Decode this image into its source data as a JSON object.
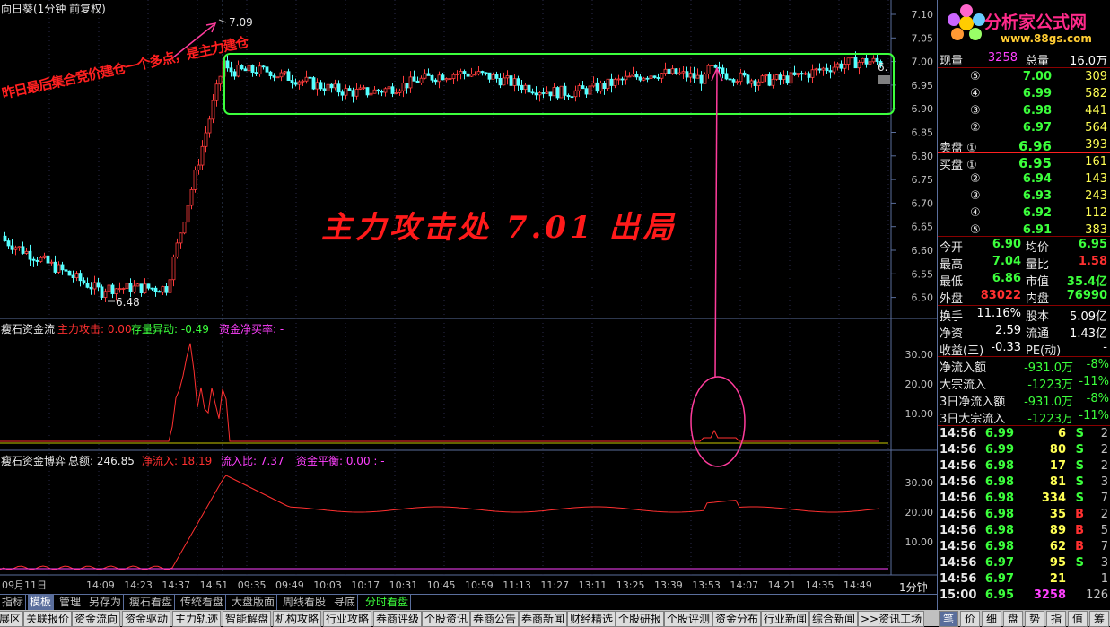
{
  "main": {
    "title": "向日葵(1分钟 前复权)",
    "annot_peak": "7.09",
    "annot_low": "6.48",
    "annot_left": "昨日最后集合竞价建仓一个多点，是主力建仓",
    "annot_center": "主力攻击处 7.01 出局",
    "y_ticks": [
      "7.10",
      "7.05",
      "7.00",
      "6.95",
      "6.90",
      "6.85",
      "6.80",
      "6.75",
      "6.70",
      "6.65",
      "6.60",
      "6.55",
      "6.50"
    ],
    "last_price_tag": "6."
  },
  "panel2": {
    "name": "瘦石资金流",
    "l1": "主力攻击: 0.00",
    "l2": "存量异动: -0.49",
    "l3": "资金净买率: -",
    "y_ticks": [
      "30.00",
      "20.00",
      "10.00"
    ]
  },
  "panel3": {
    "name": "瘦石资金博弈",
    "l1": "总额: 246.85",
    "l2": "净流入: 18.19",
    "l3": "流入比: 7.37",
    "l4": "资金平衡: 0.00 : -",
    "y_ticks": [
      "30.00",
      "20.00",
      "10.00"
    ]
  },
  "x_axis": [
    "09月11日",
    "14:09",
    "14:23",
    "14:37",
    "14:51",
    "09:35",
    "09:49",
    "10:03",
    "10:17",
    "10:31",
    "10:45",
    "10:59",
    "11:13",
    "11:27",
    "13:11",
    "13:25",
    "13:39",
    "13:53",
    "14:07",
    "14:21",
    "14:35",
    "14:49"
  ],
  "period_label": "1分钟",
  "logo": {
    "name": "分析家公式网",
    "url": "www.88gs.com"
  },
  "quote": {
    "xl_label": "现量",
    "xl_val": "3258",
    "zl_label": "总量",
    "zl_val": "16.0万",
    "sell": [
      {
        "n": "⑤",
        "p": "7.00",
        "v": "309"
      },
      {
        "n": "④",
        "p": "6.99",
        "v": "582"
      },
      {
        "n": "③",
        "p": "6.98",
        "v": "441"
      },
      {
        "n": "②",
        "p": "6.97",
        "v": "564"
      },
      {
        "n": "卖盘 ①",
        "p": "6.96",
        "v": "393"
      }
    ],
    "buy": [
      {
        "n": "买盘 ①",
        "p": "6.95",
        "v": "161"
      },
      {
        "n": "②",
        "p": "6.94",
        "v": "143"
      },
      {
        "n": "③",
        "p": "6.93",
        "v": "243"
      },
      {
        "n": "④",
        "p": "6.92",
        "v": "112"
      },
      {
        "n": "⑤",
        "p": "6.91",
        "v": "383"
      }
    ],
    "stats": [
      {
        "a": "今开",
        "av": "6.90",
        "b": "均价",
        "bv": "6.95"
      },
      {
        "a": "最高",
        "av": "7.04",
        "b": "量比",
        "bv": "1.58"
      },
      {
        "a": "最低",
        "av": "6.86",
        "b": "市值",
        "bv": "35.4亿"
      },
      {
        "a": "外盘",
        "av": "83022",
        "b": "内盘",
        "bv": "76990"
      }
    ],
    "stats2": [
      {
        "a": "换手",
        "av": "11.16%",
        "b": "股本",
        "bv": "5.09亿"
      },
      {
        "a": "净资",
        "av": "2.59",
        "b": "流通",
        "bv": "1.43亿"
      },
      {
        "a": "收益(三)",
        "av": "-0.33",
        "b": "PE(动)",
        "bv": "-"
      }
    ],
    "flows": [
      {
        "a": "净流入额",
        "v": "-931.0万",
        "p": "-8%"
      },
      {
        "a": "大宗流入",
        "v": "-1223万",
        "p": "-11%"
      },
      {
        "a": "3日净流入额",
        "v": "-931.0万",
        "p": "-8%"
      },
      {
        "a": "3日大宗流入",
        "v": "-1223万",
        "p": "-11%"
      }
    ],
    "ticks": [
      {
        "t": "14:56",
        "p": "6.99",
        "v": "6",
        "s": "S",
        "n": "2"
      },
      {
        "t": "14:56",
        "p": "6.99",
        "v": "80",
        "s": "S",
        "n": "2"
      },
      {
        "t": "14:56",
        "p": "6.98",
        "v": "17",
        "s": "S",
        "n": "2"
      },
      {
        "t": "14:56",
        "p": "6.98",
        "v": "81",
        "s": "S",
        "n": "3"
      },
      {
        "t": "14:56",
        "p": "6.98",
        "v": "334",
        "s": "S",
        "n": "7"
      },
      {
        "t": "14:56",
        "p": "6.98",
        "v": "35",
        "s": "B",
        "n": "2"
      },
      {
        "t": "14:56",
        "p": "6.98",
        "v": "89",
        "s": "B",
        "n": "5"
      },
      {
        "t": "14:56",
        "p": "6.98",
        "v": "62",
        "s": "B",
        "n": "7"
      },
      {
        "t": "14:56",
        "p": "6.97",
        "v": "95",
        "s": "S",
        "n": "3"
      },
      {
        "t": "14:56",
        "p": "6.97",
        "v": "21",
        "s": "",
        "n": "1"
      },
      {
        "t": "15:00",
        "p": "6.95",
        "v": "3258",
        "s": "",
        "n": "126"
      }
    ]
  },
  "tabs": [
    "指标",
    "模板",
    "管理",
    "另存为",
    "瘦石看盘",
    "传统看盘",
    "大盘版面",
    "周线看股",
    "寻底",
    "分时看盘"
  ],
  "bottom_tabs": [
    "展区",
    "关联报价",
    "资金流向",
    "资金驱动",
    "主力轨迹",
    "智能解盘",
    "机构攻略",
    "行业攻略",
    "券商评级",
    "个股资讯",
    "券商公告",
    "券商新闻",
    "财经精选",
    "个股研报",
    "个股评测",
    "资金分布",
    "行业新闻",
    "综合新闻",
    ">>资讯工场"
  ],
  "bottom_right": [
    "笔",
    "价",
    "细",
    "盘",
    "势",
    "指",
    "值",
    "筹"
  ]
}
